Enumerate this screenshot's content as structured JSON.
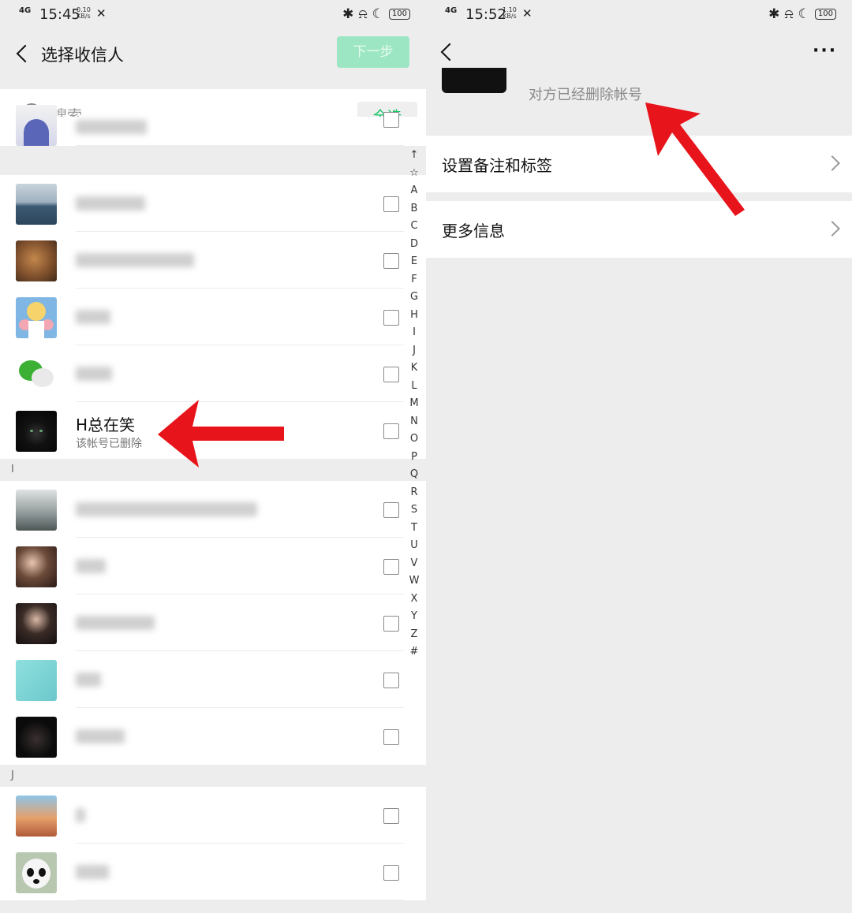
{
  "left": {
    "status": {
      "signal": "4G",
      "time": "15:45",
      "net_speed": "0.10",
      "net_unit": "KB/s",
      "battery": "100"
    },
    "header": {
      "title": "选择收信人",
      "next_label": "下一步"
    },
    "search": {
      "placeholder": "搜索",
      "select_all_label": "全选"
    },
    "sections": [
      {
        "letter": "I"
      },
      {
        "letter": "J"
      }
    ],
    "contacts": [
      {
        "name": "",
        "blurred": true
      },
      {
        "name": "",
        "blurred": true
      },
      {
        "name": "",
        "blurred": true
      },
      {
        "name": "",
        "blurred": true
      },
      {
        "name": "",
        "blurred": true
      },
      {
        "name": "H总在笑",
        "sub": "该帐号已删除",
        "blurred": false
      },
      {
        "name": "",
        "blurred": true
      },
      {
        "name": "",
        "blurred": true
      },
      {
        "name": "",
        "blurred": true
      },
      {
        "name": "",
        "blurred": true
      },
      {
        "name": "",
        "blurred": true
      },
      {
        "name": "",
        "blurred": true
      },
      {
        "name": "",
        "blurred": true
      }
    ],
    "index_letters": [
      "↑",
      "☆",
      "A",
      "B",
      "C",
      "D",
      "E",
      "F",
      "G",
      "H",
      "I",
      "J",
      "K",
      "L",
      "M",
      "N",
      "O",
      "P",
      "Q",
      "R",
      "S",
      "T",
      "U",
      "V",
      "W",
      "X",
      "Y",
      "Z",
      "#"
    ]
  },
  "right": {
    "status": {
      "signal": "4G",
      "time": "15:52",
      "net_speed": "1.10",
      "net_unit": "KB/s",
      "battery": "100"
    },
    "more_label": "···",
    "deleted_note": "对方已经删除帐号",
    "rows": [
      {
        "label": "设置备注和标签"
      },
      {
        "label": "更多信息"
      }
    ]
  },
  "colors": {
    "accent": "#07c160",
    "next_button": "#9de6c3",
    "arrow": "#e8141b"
  }
}
